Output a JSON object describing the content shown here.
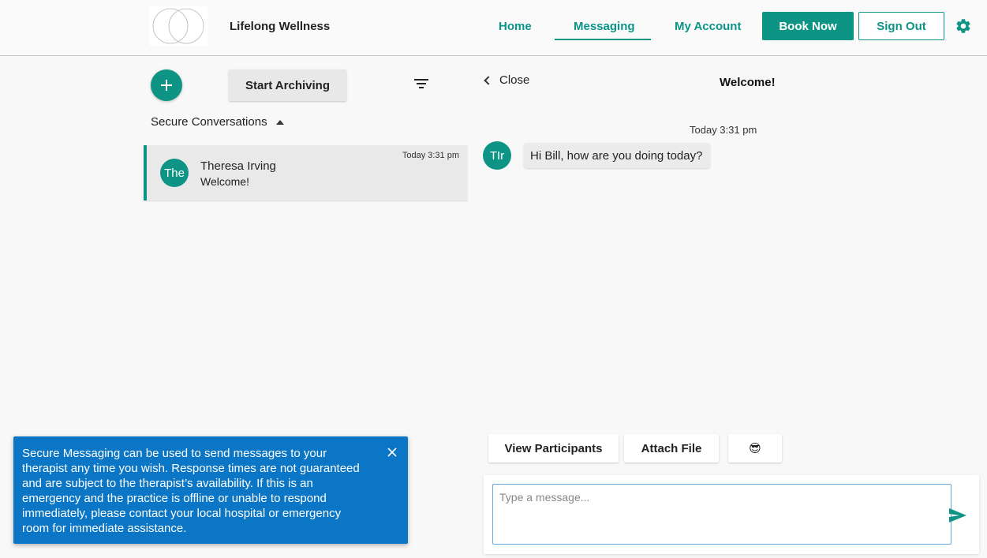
{
  "header": {
    "brand": "Lifelong Wellness",
    "nav": [
      {
        "label": "Home"
      },
      {
        "label": "Messaging"
      },
      {
        "label": "My Account"
      }
    ],
    "book_now": "Book Now",
    "sign_out": "Sign Out",
    "icons": {
      "settings": "gear-icon",
      "logo": "interlocking-circles-logo"
    }
  },
  "sidebar": {
    "archive_button": "Start Archiving",
    "section_label": "Secure Conversations",
    "conversations": [
      {
        "avatar": "The",
        "name": "Theresa Irving",
        "preview": "Welcome!",
        "time": "Today 3:31 pm"
      }
    ]
  },
  "thread": {
    "close_label": "Close",
    "title": "Welcome!",
    "messages": [
      {
        "time": "Today 3:31 pm",
        "avatar": "TIr",
        "text": "Hi Bill, how are you doing today?"
      }
    ],
    "actions": {
      "view_participants": "View Participants",
      "attach_file": "Attach File",
      "emoji": "😎"
    },
    "composer": {
      "placeholder": "Type a message..."
    }
  },
  "notice": {
    "text": "Secure Messaging can be used to send messages to your therapist any time you wish. Response times are not guaranteed and are subject to the therapist’s availability. If this is an emergency and the practice is offline or unable to respond immediately, please contact your local hospital or emergency room for immediate assistance."
  },
  "colors": {
    "accent": "#0e9485",
    "notice_bg": "#0b76c5"
  }
}
